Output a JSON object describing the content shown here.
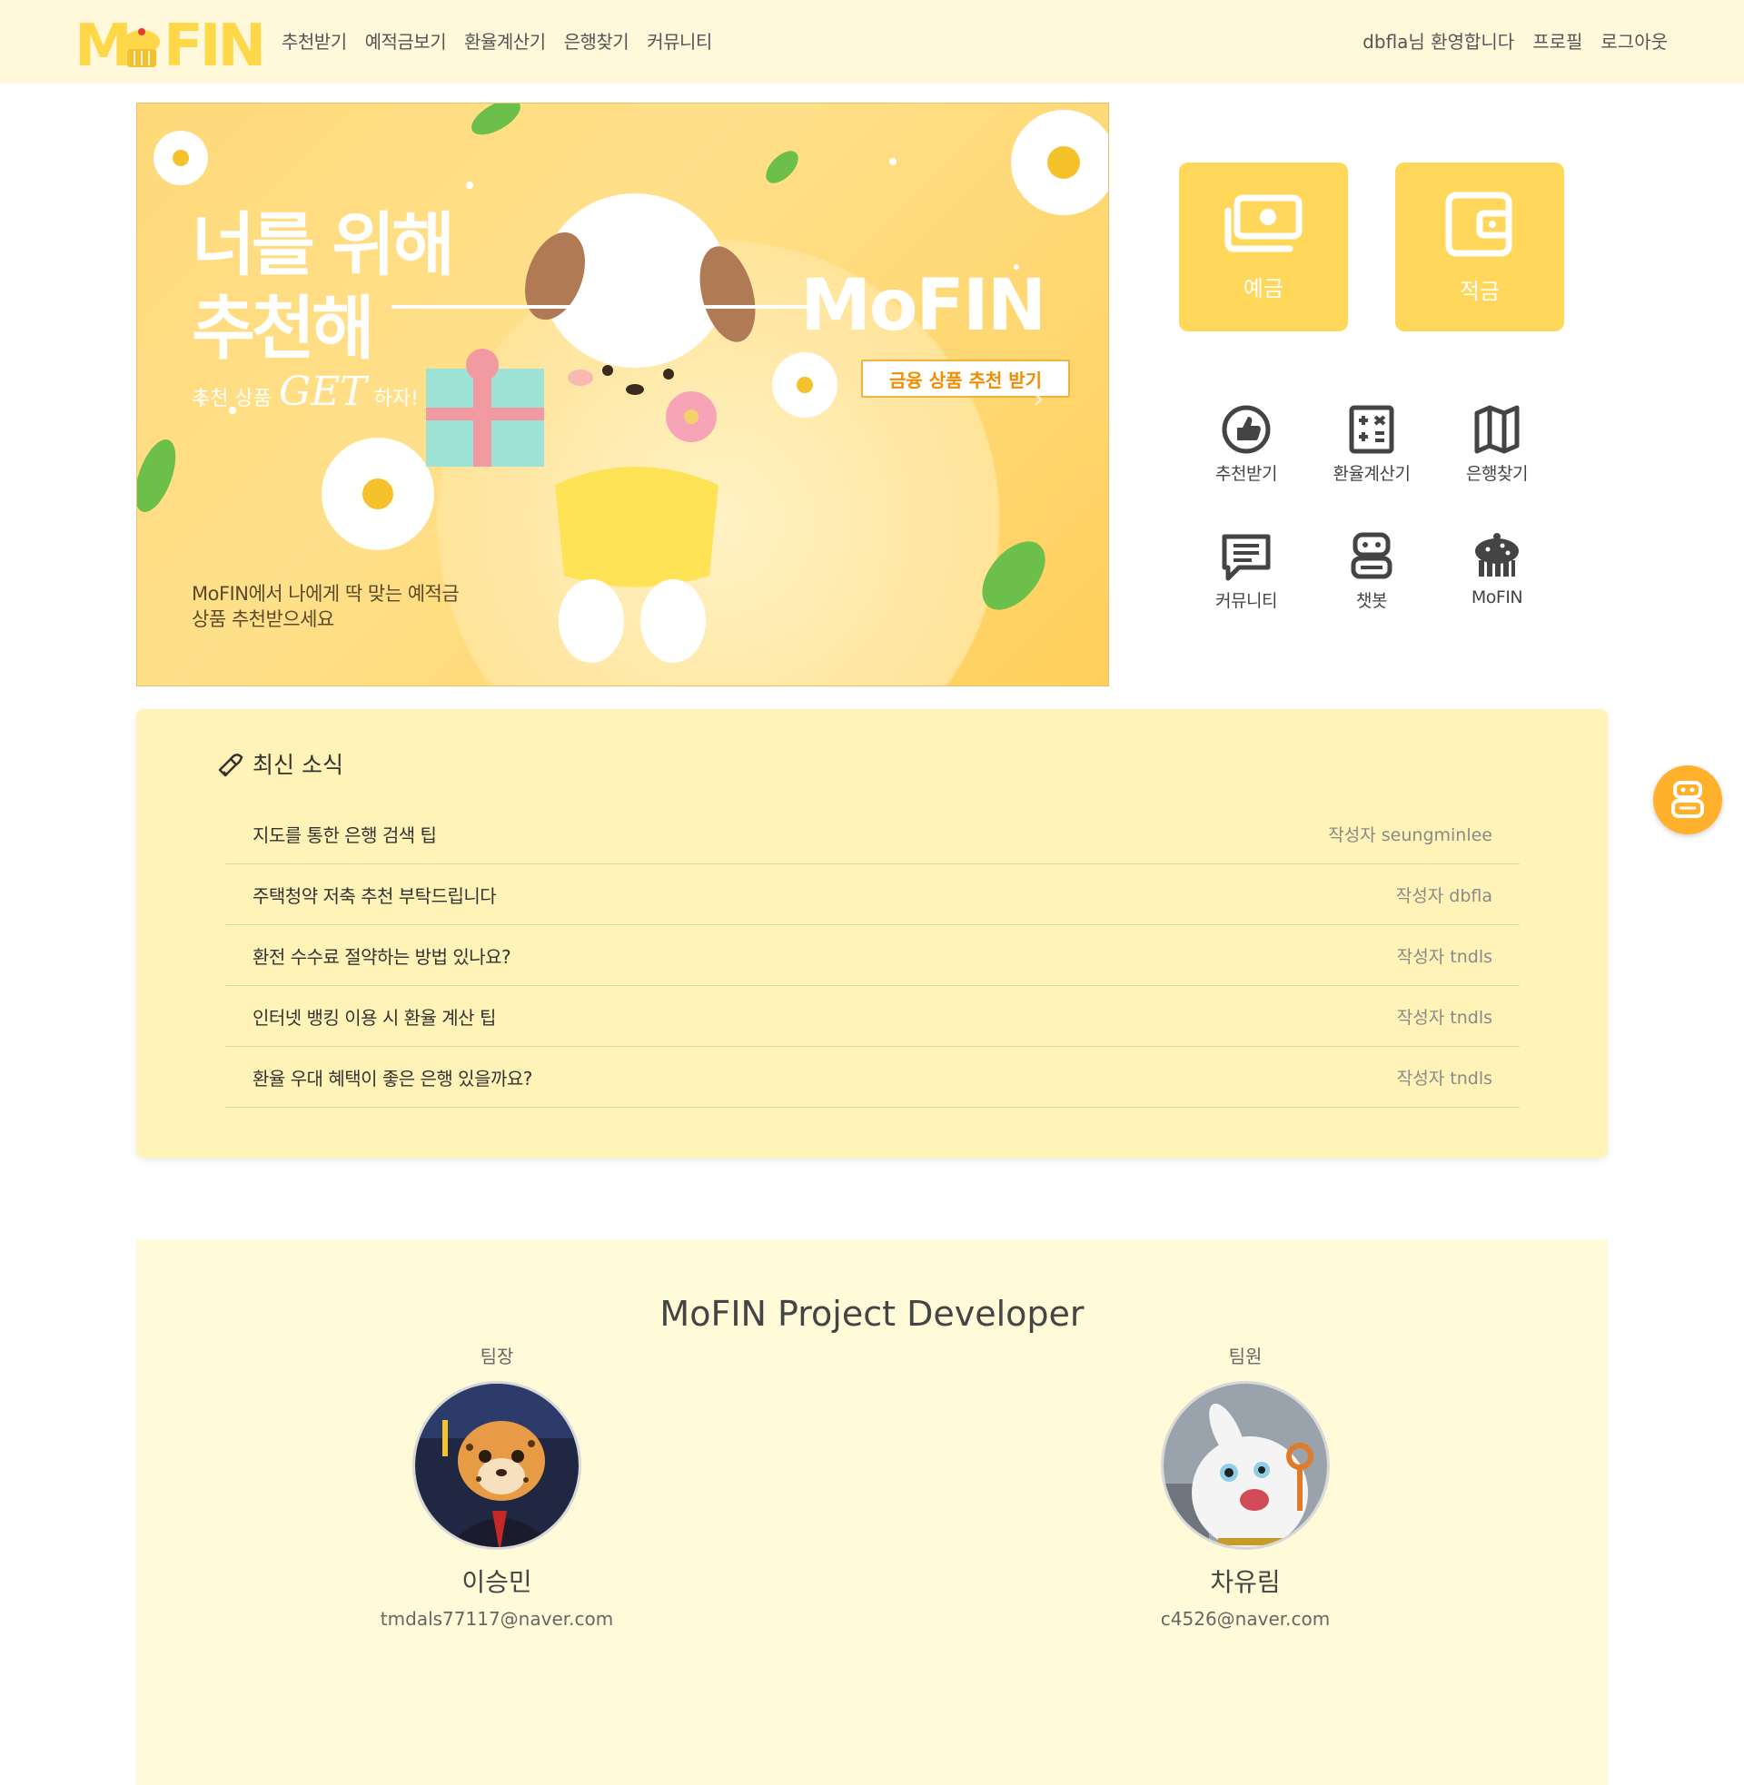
{
  "brand": {
    "logo_text": "MoFIN",
    "accent": "#ffd84a",
    "primary": "#ffd75a",
    "fab_color": "#ffb12b"
  },
  "nav": {
    "links": [
      "추천받기",
      "예적금보기",
      "환율계산기",
      "은행찾기",
      "커뮤니티"
    ],
    "welcome": "dbfla님 환영합니다",
    "profile": "프로필",
    "logout": "로그아웃"
  },
  "banner": {
    "headline_1": "너를 위해",
    "headline_2": "추천해",
    "sub_1": "추천 상품",
    "sub_get": "GET",
    "sub_2": "하자!",
    "brand": "MoFIN",
    "cta": "금융 상품 추천 받기",
    "caption_1": "MoFIN에서 나에게 딱 맞는 예적금",
    "caption_2": "상품 추천받으세요",
    "prev": "‹",
    "next": "›"
  },
  "quick": {
    "deposit": {
      "label": "예금",
      "icon": "money-icon"
    },
    "saving": {
      "label": "적금",
      "icon": "wallet-icon"
    }
  },
  "menu": [
    {
      "label": "추천받기",
      "icon": "thumbs-up-icon"
    },
    {
      "label": "환율계산기",
      "icon": "calculator-icon"
    },
    {
      "label": "은행찾기",
      "icon": "map-icon"
    },
    {
      "label": "커뮤니티",
      "icon": "message-icon"
    },
    {
      "label": "챗봇",
      "icon": "robot-icon"
    },
    {
      "label": "MoFIN",
      "icon": "muffin-icon"
    }
  ],
  "news": {
    "title": "최신 소식",
    "items": [
      {
        "title": "지도를 통한 은행 검색 팁",
        "author": "작성자 seungminlee"
      },
      {
        "title": "주택청약 저축 추천 부탁드립니다",
        "author": "작성자 dbfla"
      },
      {
        "title": "환전 수수료 절약하는 방법 있나요?",
        "author": "작성자 tndls"
      },
      {
        "title": "인터넷 뱅킹 이용 시 환율 계산 팁",
        "author": "작성자 tndls"
      },
      {
        "title": "환율 우대 혜택이 좋은 은행 있을까요?",
        "author": "작성자 tndls"
      }
    ]
  },
  "developers": {
    "heading": "MoFIN Project Developer",
    "members": [
      {
        "role": "팀장",
        "name": "이승민",
        "email": "tmdals77117@naver.com"
      },
      {
        "role": "팀원",
        "name": "차유림",
        "email": "c4526@naver.com"
      }
    ]
  }
}
